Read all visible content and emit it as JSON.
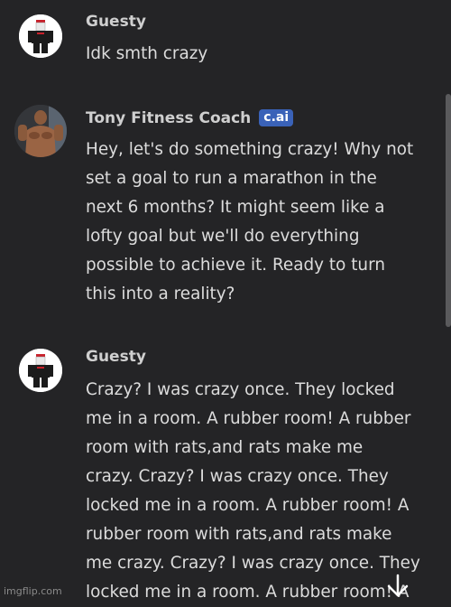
{
  "messages": [
    {
      "sender": "Guesty",
      "text": "Idk smth crazy",
      "avatar": "roblox-guest-avatar"
    },
    {
      "sender": "Tony Fitness Coach",
      "badge": "c.ai",
      "avatar": "fitness-coach-avatar",
      "lines": [
        "Hey, let's do something crazy! Why not",
        "set a goal to run a marathon in the",
        "next 6 months? It might seem like a",
        "lofty goal but we'll do everything",
        "possible to achieve it. Ready to turn",
        "this into a reality?"
      ]
    },
    {
      "sender": "Guesty",
      "avatar": "roblox-guest-avatar",
      "lines": [
        "Crazy? I was crazy once. They locked",
        "me in a room. A rubber room! A rubber",
        "room with rats,and rats make me",
        "crazy. Crazy? I was crazy once. They",
        "locked me in a room. A rubber room! A",
        "rubber room with rats,and rats make",
        "me crazy. Crazy? I was crazy once. They",
        "locked me in a room. A rubber room! A"
      ]
    }
  ],
  "watermark": "imgflip.com",
  "icons": {
    "scroll_down": "arrow-down-icon"
  }
}
